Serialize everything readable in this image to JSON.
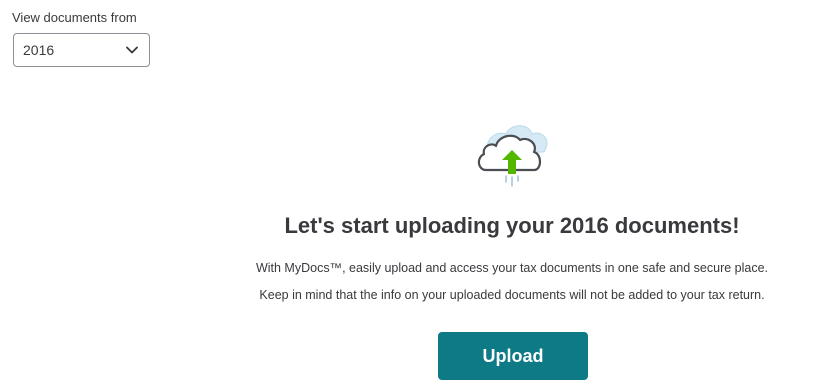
{
  "filter": {
    "label": "View documents from",
    "selected_year": "2016",
    "chevron_icon": "chevron-down-icon"
  },
  "empty_state": {
    "illustration_icon": "cloud-upload-icon",
    "headline": "Let's start uploading your 2016 documents!",
    "description_line_1": "With MyDocs™, easily upload and access your tax documents in one safe and secure place.",
    "description_line_2": "Keep in mind that the info on your uploaded documents will not be added to your tax return.",
    "upload_button_label": "Upload"
  },
  "colors": {
    "primary_button": "#0d7a86",
    "arrow_green": "#53b700",
    "text": "#393a3d",
    "cloud_back": "#cfe6f3"
  }
}
